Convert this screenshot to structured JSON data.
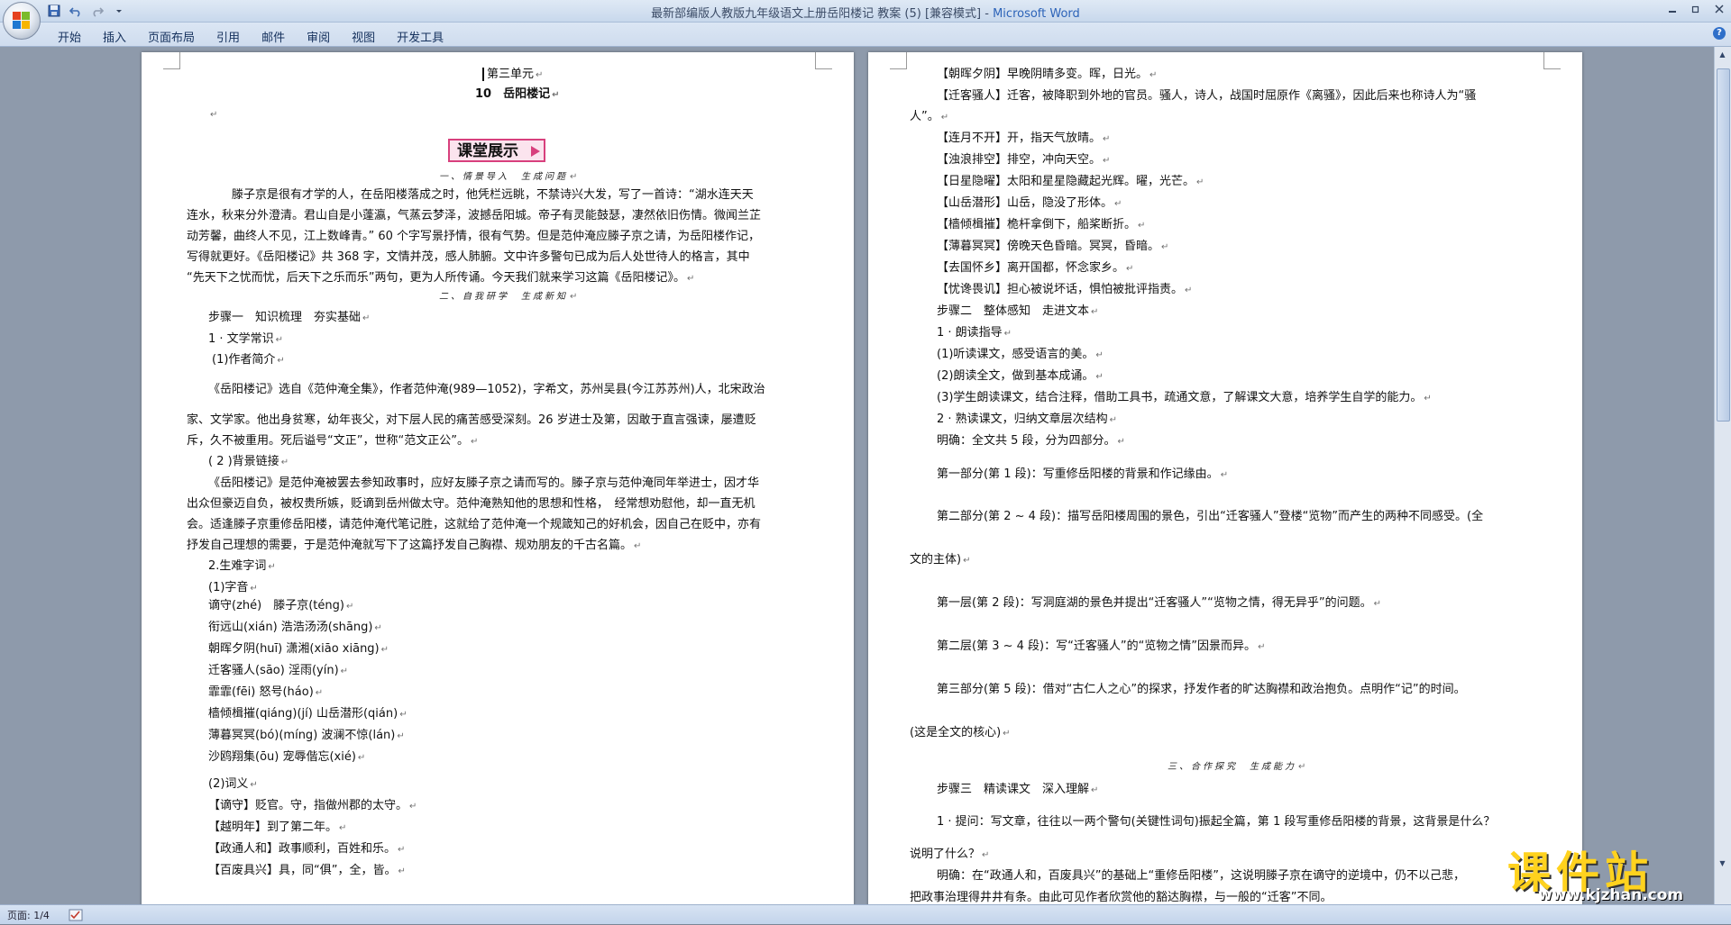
{
  "window": {
    "title_doc": "最新部编版人教版九年级语文上册岳阳楼记 教案 (5) [兼容模式] - ",
    "title_app": "Microsoft Word",
    "help": "?"
  },
  "ribbon": {
    "tabs": [
      "开始",
      "插入",
      "页面布局",
      "引用",
      "邮件",
      "审阅",
      "视图",
      "开发工具"
    ]
  },
  "icons": {
    "office_button": "office-logo-icon",
    "save": "save-icon",
    "undo": "undo-icon",
    "redo": "redo-icon",
    "customize": "dropdown-icon"
  },
  "status": {
    "page": "页面: 1/4"
  },
  "watermark": {
    "text": "课件站",
    "url": "www.kjzhan.com"
  },
  "left_page": {
    "unit": "第三单元",
    "lesson": "10　岳阳楼记",
    "banner": "课堂展示",
    "sec1": "一、情景导入　生成问题",
    "p1": [
      "滕子京是很有才学的人，在岳阳楼落成之时，他凭栏远眺，不禁诗兴大发，写了一首诗：“湖水连天天",
      "连水，秋来分外澄清。君山自是小蓬瀛，气蒸云梦泽，波撼岳阳城。帝子有灵能鼓瑟，凄然依旧伤情。微闻兰芷",
      "动芳馨，曲终人不见，江上数峰青。” 60 个字写景抒情，很有气势。但是范仲淹应滕子京之请，为岳阳楼作记，",
      "写得就更好。《岳阳楼记》共 368 字，文情并茂，感人肺腑。文中许多警句已成为后人处世待人的格言，其中",
      "“先天下之忧而忧，后天下之乐而乐”两句，更为人所传诵。今天我们就来学习这篇《岳阳楼记》。"
    ],
    "sec2": "二、自我研学　生成新知",
    "step1": "步骤一　知识梳理　夯实基础",
    "h1": "1 · 文学常识",
    "h1a": "(1)作者简介",
    "p2": [
      "《岳阳楼记》选自《范仲淹全集》，作者范仲淹(989—1052)，字希文，苏州吴县(今江苏苏州)人，北宋政治",
      "家、文学家。他出身贫寒，幼年丧父，对下层人民的痛苦感受深刻。26 岁进士及第，因敢于直言强谏，屡遭贬",
      "斥，久不被重用。死后谥号“文正”，世称“范文正公”。"
    ],
    "h1b": "( 2 )背景链接",
    "p3": [
      "《岳阳楼记》是范仲淹被罢去参知政事时，应好友滕子京之请而写的。滕子京与范仲淹同年举进士，因才华",
      "出众但豪迈自负，被权贵所嫉，贬谪到岳州做太守。范仲淹熟知他的思想和性格，　经常想劝慰他，却一直无机",
      "会。适逢滕子京重修岳阳楼，请范仲淹代笔记胜，这就给了范仲淹一个规箴知己的好机会，因自己在贬中，亦有",
      "抒发自己理想的需要，于是范仲淹就写下了这篇抒发自己胸襟、规劝朋友的千古名篇。"
    ],
    "h2": "2.生难字词",
    "h2a": "(1)字音",
    "chars": [
      "谪守(zhé)　滕子京(téng)",
      "衔远山(xián)  浩浩汤汤(shāng)",
      "朝晖夕阴(huī)  潇湘(xiāo xiāng)",
      "迁客骚人(sāo)  淫雨(yín)",
      "霏霏(fēi)  怒号(háo)",
      "樯倾楫摧(qiáng)(jí)  山岳潜形(qián)",
      " 薄暮冥冥(bó)(míng)  波澜不惊(lán)",
      "沙鸥翔集(ōu)  宠辱偕忘(xié)"
    ],
    "h2b": " (2)词义",
    "words": [
      "【谪守】贬官。守，指做州郡的太守。",
      "【越明年】到了第二年。",
      "【政通人和】政事顺利，百姓和乐。",
      "【百废具兴】具，同“俱”，全，皆。"
    ]
  },
  "right_page": {
    "words": [
      "【朝晖夕阴】早晚阴晴多变。晖，日光。",
      "【迁客骚人】迁客，被降职到外地的官员。骚人，诗人，战国时屈原作《离骚》，因此后来也称诗人为“骚",
      "人”。",
      "【连月不开】开，指天气放晴。",
      "【浊浪排空】排空，冲向天空。",
      "【日星隐曜】太阳和星星隐藏起光辉。曜，光芒。",
      "【山岳潜形】山岳，隐没了形体。",
      "【樯倾楫摧】桅杆拿倒下，船桨断折。",
      "【薄暮冥冥】傍晚天色昏暗。冥冥，昏暗。",
      "【去国怀乡】离开国都，怀念家乡。",
      "【忧谗畏讥】担心被说坏话，惧怕被批评指责。"
    ],
    "step2": "步骤二　整体感知　走进文本",
    "r1": "1 · 朗读指导",
    "r1a": "(1)听读课文，感受语言的美。",
    "r1b": "(2)朗读全文，做到基本成诵。",
    "r1c": " (3)学生朗读课文，结合注释，借助工具书，疏通文意，了解课文大意，培养学生自学的能力。",
    "r2": "2 · 熟读课文，归纳文章层次结构",
    "r2a": "明确：全文共 5 段，分为四部分。",
    "part1": "第一部分(第 1 段)：写重修岳阳楼的背景和作记缘由。",
    "part2": "第二部分(第 2 ~ 4 段)：描写岳阳楼周围的景色，引出“迁客骚人”登楼“览物”而产生的两种不同感受。(全",
    "part2b": "文的主体)",
    "layer1": "第一层(第 2 段)：写洞庭湖的景色并提出“迁客骚人”“览物之情，得无异乎”的问题。",
    "layer2": "第二层(第 3 ~ 4 段)：写“迁客骚人”的“览物之情”因景而异。",
    "part3": "第三部分(第 5 段)：借对“古仁人之心”的探求，抒发作者的旷达胸襟和政治抱负。点明作“记”的时间。",
    "part3b": "(这是全文的核心)",
    "sec3": "三、合作探究　生成能力",
    "step3": "步骤三　精读课文　深入理解",
    "q1": "1 · 提问：写文章，往往以一两个警句(关键性词句)振起全篇，第 1 段写重修岳阳楼的背景，这背景是什么？",
    "q1b": "说明了什么？",
    "a1": "明确：在“政通人和，百废具兴”的基础上“重修岳阳楼”，这说明滕子京在谪守的逆境中，仍不以己悲，",
    "a1b": "把政事治理得井井有条。由此可见作者欣赏他的豁达胸襟，与一般的“迁客”不同。"
  }
}
